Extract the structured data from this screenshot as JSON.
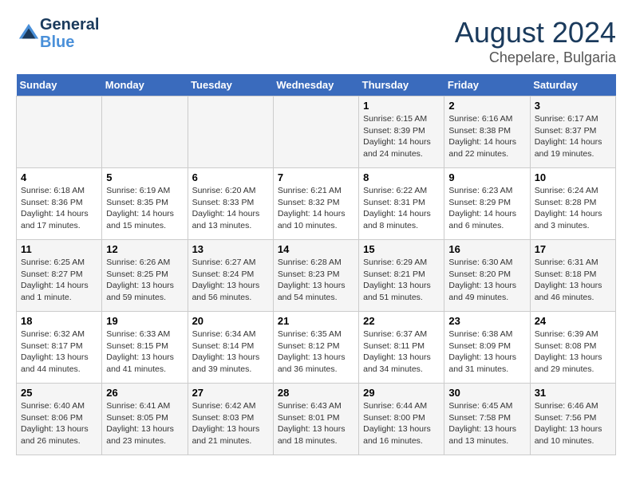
{
  "header": {
    "logo_line1": "General",
    "logo_line2": "Blue",
    "main_title": "August 2024",
    "subtitle": "Chepelare, Bulgaria"
  },
  "days_of_week": [
    "Sunday",
    "Monday",
    "Tuesday",
    "Wednesday",
    "Thursday",
    "Friday",
    "Saturday"
  ],
  "weeks": [
    [
      {
        "day": "",
        "info": ""
      },
      {
        "day": "",
        "info": ""
      },
      {
        "day": "",
        "info": ""
      },
      {
        "day": "",
        "info": ""
      },
      {
        "day": "1",
        "info": "Sunrise: 6:15 AM\nSunset: 8:39 PM\nDaylight: 14 hours and 24 minutes."
      },
      {
        "day": "2",
        "info": "Sunrise: 6:16 AM\nSunset: 8:38 PM\nDaylight: 14 hours and 22 minutes."
      },
      {
        "day": "3",
        "info": "Sunrise: 6:17 AM\nSunset: 8:37 PM\nDaylight: 14 hours and 19 minutes."
      }
    ],
    [
      {
        "day": "4",
        "info": "Sunrise: 6:18 AM\nSunset: 8:36 PM\nDaylight: 14 hours and 17 minutes."
      },
      {
        "day": "5",
        "info": "Sunrise: 6:19 AM\nSunset: 8:35 PM\nDaylight: 14 hours and 15 minutes."
      },
      {
        "day": "6",
        "info": "Sunrise: 6:20 AM\nSunset: 8:33 PM\nDaylight: 14 hours and 13 minutes."
      },
      {
        "day": "7",
        "info": "Sunrise: 6:21 AM\nSunset: 8:32 PM\nDaylight: 14 hours and 10 minutes."
      },
      {
        "day": "8",
        "info": "Sunrise: 6:22 AM\nSunset: 8:31 PM\nDaylight: 14 hours and 8 minutes."
      },
      {
        "day": "9",
        "info": "Sunrise: 6:23 AM\nSunset: 8:29 PM\nDaylight: 14 hours and 6 minutes."
      },
      {
        "day": "10",
        "info": "Sunrise: 6:24 AM\nSunset: 8:28 PM\nDaylight: 14 hours and 3 minutes."
      }
    ],
    [
      {
        "day": "11",
        "info": "Sunrise: 6:25 AM\nSunset: 8:27 PM\nDaylight: 14 hours and 1 minute."
      },
      {
        "day": "12",
        "info": "Sunrise: 6:26 AM\nSunset: 8:25 PM\nDaylight: 13 hours and 59 minutes."
      },
      {
        "day": "13",
        "info": "Sunrise: 6:27 AM\nSunset: 8:24 PM\nDaylight: 13 hours and 56 minutes."
      },
      {
        "day": "14",
        "info": "Sunrise: 6:28 AM\nSunset: 8:23 PM\nDaylight: 13 hours and 54 minutes."
      },
      {
        "day": "15",
        "info": "Sunrise: 6:29 AM\nSunset: 8:21 PM\nDaylight: 13 hours and 51 minutes."
      },
      {
        "day": "16",
        "info": "Sunrise: 6:30 AM\nSunset: 8:20 PM\nDaylight: 13 hours and 49 minutes."
      },
      {
        "day": "17",
        "info": "Sunrise: 6:31 AM\nSunset: 8:18 PM\nDaylight: 13 hours and 46 minutes."
      }
    ],
    [
      {
        "day": "18",
        "info": "Sunrise: 6:32 AM\nSunset: 8:17 PM\nDaylight: 13 hours and 44 minutes."
      },
      {
        "day": "19",
        "info": "Sunrise: 6:33 AM\nSunset: 8:15 PM\nDaylight: 13 hours and 41 minutes."
      },
      {
        "day": "20",
        "info": "Sunrise: 6:34 AM\nSunset: 8:14 PM\nDaylight: 13 hours and 39 minutes."
      },
      {
        "day": "21",
        "info": "Sunrise: 6:35 AM\nSunset: 8:12 PM\nDaylight: 13 hours and 36 minutes."
      },
      {
        "day": "22",
        "info": "Sunrise: 6:37 AM\nSunset: 8:11 PM\nDaylight: 13 hours and 34 minutes."
      },
      {
        "day": "23",
        "info": "Sunrise: 6:38 AM\nSunset: 8:09 PM\nDaylight: 13 hours and 31 minutes."
      },
      {
        "day": "24",
        "info": "Sunrise: 6:39 AM\nSunset: 8:08 PM\nDaylight: 13 hours and 29 minutes."
      }
    ],
    [
      {
        "day": "25",
        "info": "Sunrise: 6:40 AM\nSunset: 8:06 PM\nDaylight: 13 hours and 26 minutes."
      },
      {
        "day": "26",
        "info": "Sunrise: 6:41 AM\nSunset: 8:05 PM\nDaylight: 13 hours and 23 minutes."
      },
      {
        "day": "27",
        "info": "Sunrise: 6:42 AM\nSunset: 8:03 PM\nDaylight: 13 hours and 21 minutes."
      },
      {
        "day": "28",
        "info": "Sunrise: 6:43 AM\nSunset: 8:01 PM\nDaylight: 13 hours and 18 minutes."
      },
      {
        "day": "29",
        "info": "Sunrise: 6:44 AM\nSunset: 8:00 PM\nDaylight: 13 hours and 16 minutes."
      },
      {
        "day": "30",
        "info": "Sunrise: 6:45 AM\nSunset: 7:58 PM\nDaylight: 13 hours and 13 minutes."
      },
      {
        "day": "31",
        "info": "Sunrise: 6:46 AM\nSunset: 7:56 PM\nDaylight: 13 hours and 10 minutes."
      }
    ]
  ]
}
